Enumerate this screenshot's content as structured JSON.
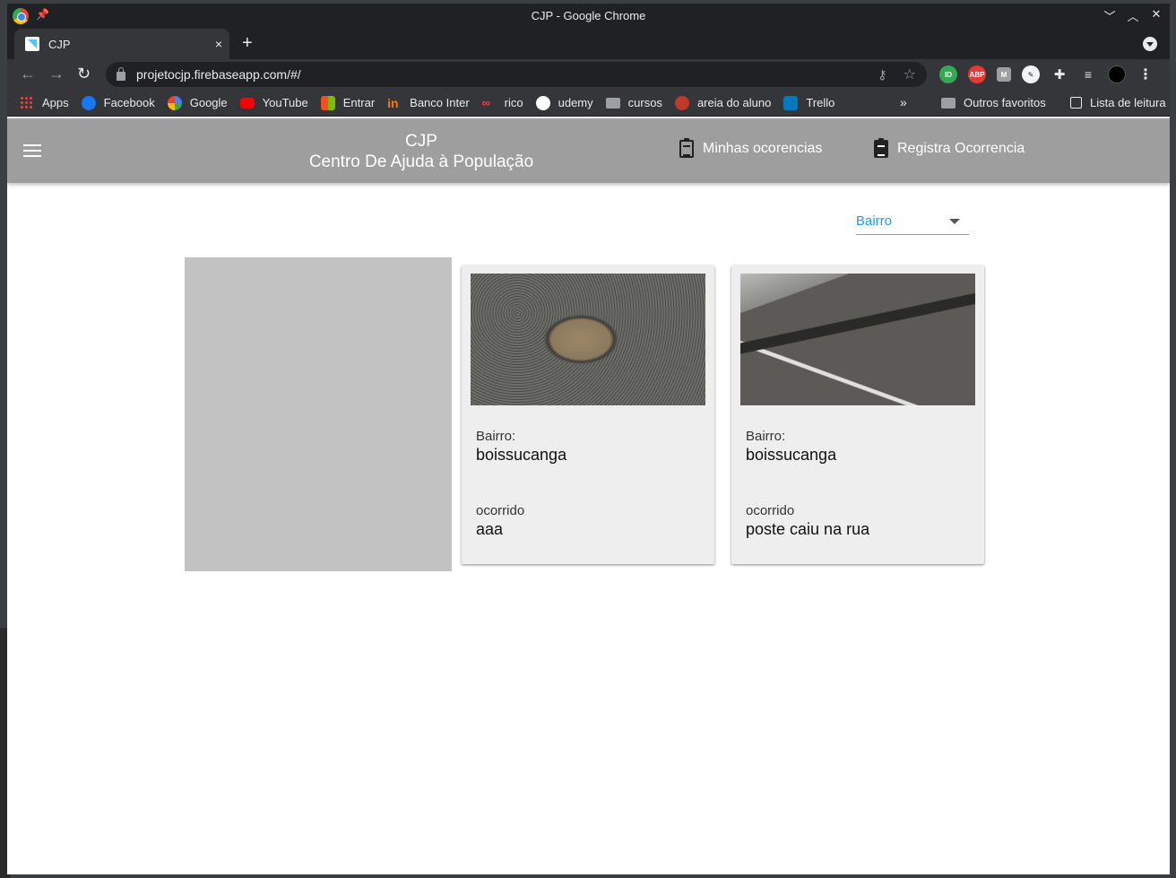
{
  "window": {
    "title": "CJP - Google Chrome",
    "controls": [
      "minimize",
      "maximize",
      "close"
    ]
  },
  "tab": {
    "title": "CJP",
    "close_glyph": "×",
    "new_tab_glyph": "+"
  },
  "toolbar": {
    "url": "projetocjp.firebaseapp.com/#/"
  },
  "bookmarks": {
    "items": [
      {
        "label": "Apps",
        "icon": "apps-grid-icon"
      },
      {
        "label": "Facebook",
        "icon": "facebook-icon"
      },
      {
        "label": "Google",
        "icon": "google-icon"
      },
      {
        "label": "YouTube",
        "icon": "youtube-icon"
      },
      {
        "label": "Entrar",
        "icon": "microsoft-icon"
      },
      {
        "label": "Banco Inter",
        "icon": "banco-inter-icon"
      },
      {
        "label": "rico",
        "icon": "rico-icon"
      },
      {
        "label": "udemy",
        "icon": "udemy-icon"
      },
      {
        "label": "cursos",
        "icon": "folder-icon"
      },
      {
        "label": "areia do aluno",
        "icon": "areia-icon"
      },
      {
        "label": "Trello",
        "icon": "trello-icon"
      }
    ],
    "more_glyph": "»",
    "other_favorites": "Outros favoritos",
    "reading_list": "Lista de leitura"
  },
  "app": {
    "title_line1": "CJP",
    "title_line2": "Centro De Ajuda à População",
    "nav_minhas": "Minhas ocorencias",
    "nav_registra": "Registra Ocorrencia",
    "appbar_color": "#9e9e9e",
    "accent_color": "#2196f3"
  },
  "filter": {
    "label": "Bairro"
  },
  "cards": [
    {
      "image": "pothole-photo",
      "bairro_label": "Bairro:",
      "bairro_value": "boissucanga",
      "ocorrido_label": "ocorrido",
      "ocorrido_value": "aaa"
    },
    {
      "image": "fallen-pole-photo",
      "bairro_label": "Bairro:",
      "bairro_value": "boissucanga",
      "ocorrido_label": "ocorrido",
      "ocorrido_value": "poste caiu na rua"
    }
  ]
}
